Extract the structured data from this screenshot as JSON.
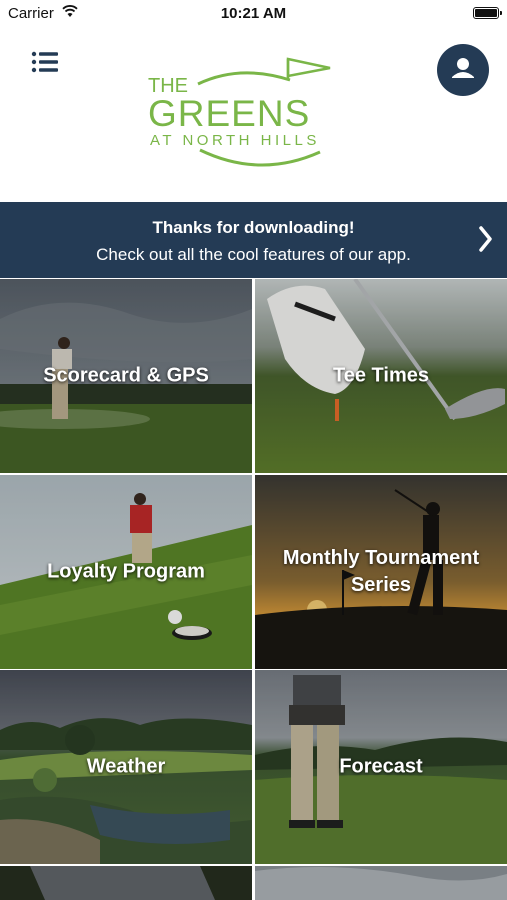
{
  "status_bar": {
    "carrier": "Carrier",
    "time": "10:21 AM"
  },
  "header": {
    "menu_icon": "hamburger-menu-icon",
    "profile_icon": "user-icon",
    "logo": {
      "line1": "THE",
      "line2": "GREENS",
      "line3": "AT NORTH HILLS",
      "brand_green": "#7ab648"
    }
  },
  "banner": {
    "title": "Thanks for downloading!",
    "subtitle": "Check out all the cool features of our app.",
    "chevron_icon": "chevron-right-icon",
    "background": "#243b55"
  },
  "tiles": [
    {
      "label": "Scorecard & GPS"
    },
    {
      "label": "Tee Times"
    },
    {
      "label": "Loyalty Program"
    },
    {
      "label": "Monthly Tournament Series"
    },
    {
      "label": "Weather"
    },
    {
      "label": "Forecast"
    }
  ],
  "colors": {
    "navy": "#243b55",
    "green": "#7ab648"
  }
}
